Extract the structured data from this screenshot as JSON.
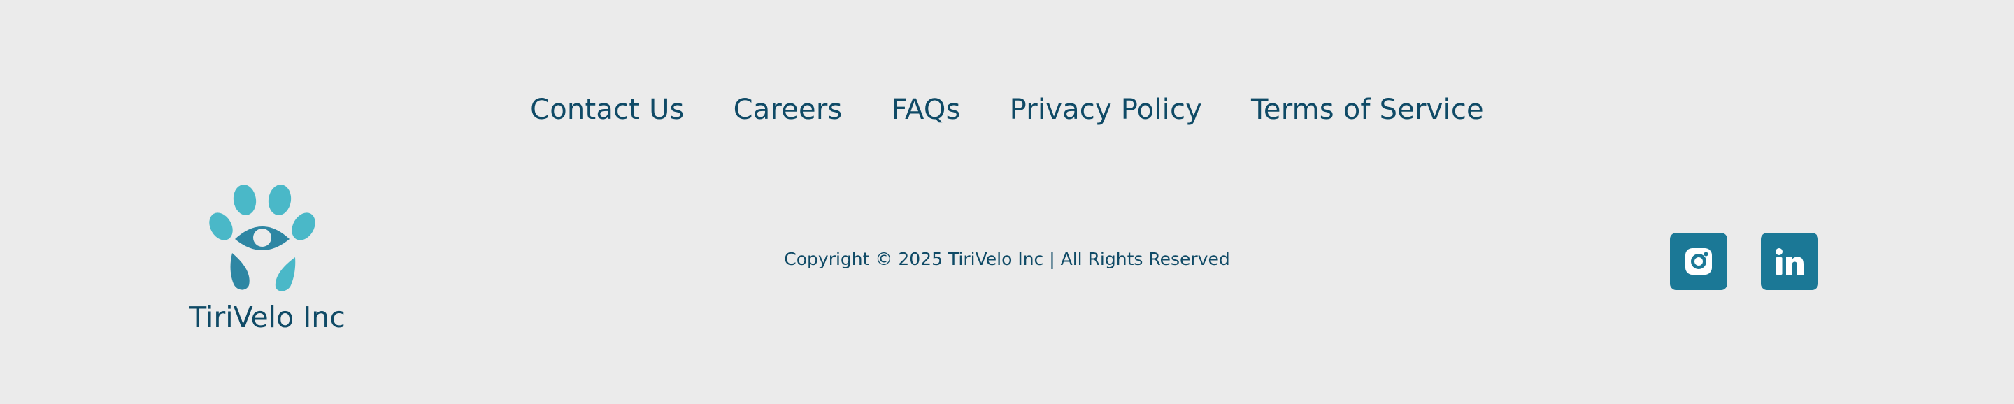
{
  "nav": {
    "links": [
      {
        "label": "Contact Us"
      },
      {
        "label": "Careers"
      },
      {
        "label": "FAQs"
      },
      {
        "label": "Privacy Policy"
      },
      {
        "label": "Terms of Service"
      }
    ]
  },
  "brand": {
    "name": "TiriVelo Inc",
    "logo_icon": "paw-eye-logo",
    "logo_colors": {
      "light": "#4ab8c8",
      "dark": "#2e86a3"
    }
  },
  "footer": {
    "copyright": "Copyright © 2025 TiriVelo Inc | All Rights Reserved"
  },
  "social": {
    "instagram_icon": "instagram-icon",
    "linkedin_icon": "linkedin-icon",
    "button_color": "#1b7896"
  },
  "colors": {
    "background": "#ebebeb",
    "text": "#0f4a66"
  }
}
